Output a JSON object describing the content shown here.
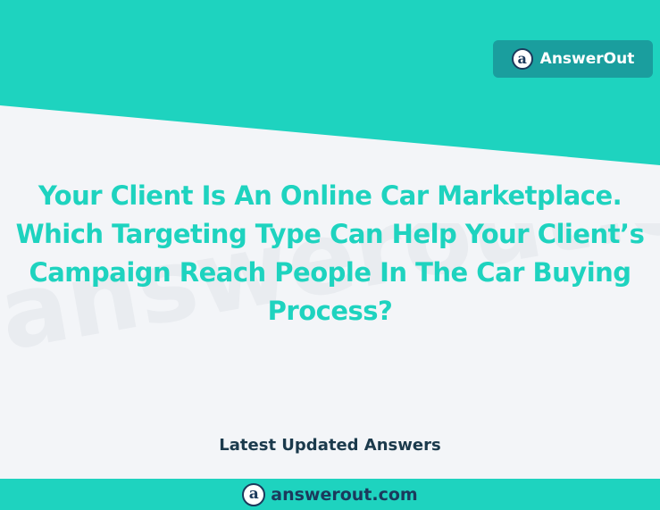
{
  "colors": {
    "teal": "#1ed3bf",
    "badge_teal": "#1a9e9e",
    "navy": "#1b3a5c",
    "background": "#f3f5f8"
  },
  "brand_badge": {
    "logo_glyph": "a",
    "icon": "answerout-logo-icon",
    "text": "AnswerOut"
  },
  "watermark": "answerout.com",
  "question": {
    "title": "Your Client Is An Online Car Marketplace. Which Targeting Type Can Help Your Client’s Campaign Reach People In The Car Buying Process?"
  },
  "subtitle": "Latest Updated Answers",
  "footer": {
    "logo_glyph": "a",
    "icon": "answerout-logo-icon",
    "domain": "answerout.com"
  }
}
